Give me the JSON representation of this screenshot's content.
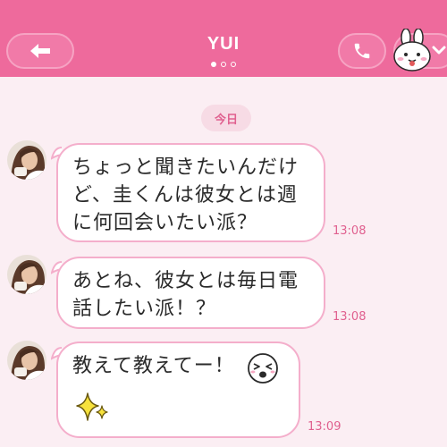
{
  "header": {
    "title": "YUI",
    "back_icon": "arrow-left-icon",
    "call_icon": "phone-icon",
    "menu_icon": "chevron-down-icon",
    "color": "#ee6a9c"
  },
  "date_divider": "今日",
  "messages": [
    {
      "lines": [
        "ちょっと聞きたいんだけ",
        "ど、圭くんは彼女とは週",
        "に何回会いたい派？"
      ],
      "time": "13:08"
    },
    {
      "lines": [
        "あとね、彼女とは毎日電",
        "話したい派！？"
      ],
      "time": "13:08"
    },
    {
      "lines": [
        "教えて教えてー！"
      ],
      "time": "13:09",
      "emoji": "winking-face-icon",
      "sticker": "sparkles-icon"
    }
  ]
}
